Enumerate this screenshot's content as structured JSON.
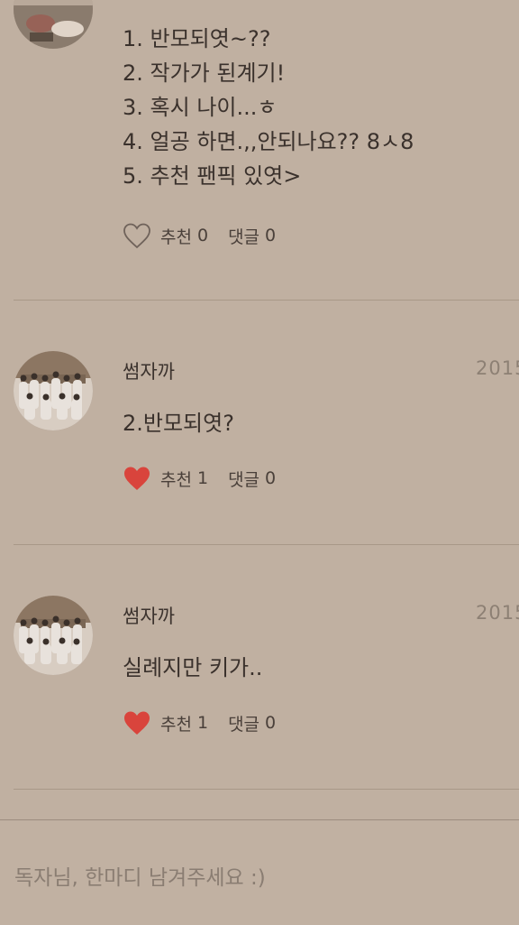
{
  "comments": [
    {
      "author": "",
      "date": "",
      "lines": [
        "1. 반모되엿~??",
        "2. 작가가 된계기!",
        "3. 혹시 나이...ㅎ",
        "4. 얼공 하면.,,안되나요?? 8ㅅ8",
        "5. 추천 팬픽 있엿>"
      ],
      "liked": false,
      "recommend_label": "추천",
      "recommend_count": "0",
      "reply_label": "댓글",
      "reply_count": "0"
    },
    {
      "author": "썸자까",
      "date": "2015",
      "text": "2.반모되엿?",
      "liked": true,
      "recommend_label": "추천",
      "recommend_count": "1",
      "reply_label": "댓글",
      "reply_count": "0"
    },
    {
      "author": "썸자까",
      "date": "2015",
      "text": "실례지만 키가..",
      "liked": true,
      "recommend_label": "추천",
      "recommend_count": "1",
      "reply_label": "댓글",
      "reply_count": "0"
    }
  ],
  "input": {
    "placeholder": "독자님, 한마디 남겨주세요 :)"
  },
  "colors": {
    "background": "#c0b0a1",
    "heart_filled": "#d9443c",
    "heart_outline": "#6f625a"
  }
}
